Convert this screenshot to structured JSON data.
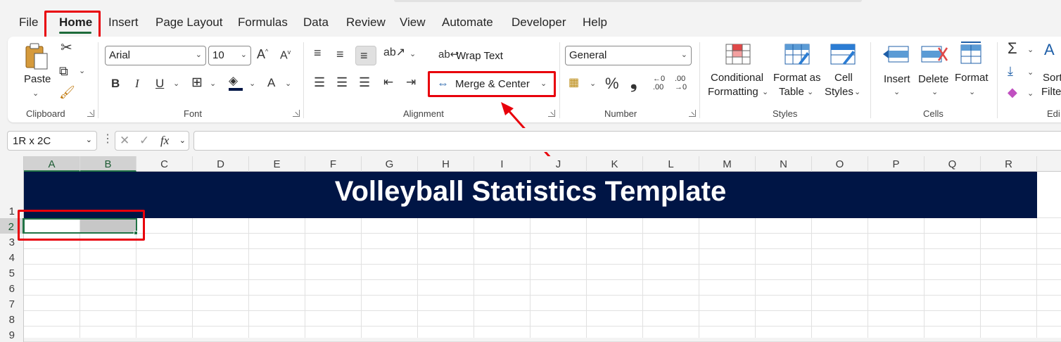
{
  "menu": {
    "tabs": [
      "File",
      "Home",
      "Insert",
      "Page Layout",
      "Formulas",
      "Data",
      "Review",
      "View",
      "Automate",
      "Developer",
      "Help"
    ]
  },
  "ribbon": {
    "clipboard": {
      "paste": "Paste",
      "label": "Clipboard"
    },
    "font": {
      "name": "Arial",
      "size": "10",
      "bold": "B",
      "italic": "I",
      "underline": "U",
      "font_color": "A",
      "grow": "A",
      "shrink": "A",
      "label": "Font"
    },
    "alignment": {
      "wrap_text": "Wrap Text",
      "merge_center": "Merge & Center",
      "label": "Alignment"
    },
    "number": {
      "format": "General",
      "percent": "%",
      "comma": "❟",
      "inc_decimal_top": "←0",
      "inc_decimal_bottom": ".00",
      "dec_decimal_top": ".00",
      "dec_decimal_bottom": "→0",
      "label": "Number"
    },
    "styles": {
      "conditional_1": "Conditional",
      "conditional_2": "Formatting",
      "format_table_1": "Format as",
      "format_table_2": "Table",
      "cell_styles_1": "Cell",
      "cell_styles_2": "Styles",
      "label": "Styles"
    },
    "cells": {
      "insert": "Insert",
      "delete": "Delete",
      "format": "Format",
      "label": "Cells"
    },
    "editing": {
      "sort_1": "Sort",
      "sort_2": "Filte",
      "label": "Edi"
    }
  },
  "formula_bar": {
    "name_box": "1R x 2C",
    "fx": "fx",
    "value": ""
  },
  "grid": {
    "columns": [
      "A",
      "B",
      "C",
      "D",
      "E",
      "F",
      "G",
      "H",
      "I",
      "J",
      "K",
      "L",
      "M",
      "N",
      "O",
      "P",
      "Q",
      "R"
    ],
    "rows": [
      "1",
      "2",
      "3",
      "4",
      "5",
      "6",
      "7",
      "8",
      "9"
    ],
    "banner_title": "Volleyball Statistics Template",
    "selected_columns": [
      "A",
      "B"
    ],
    "selected_row": "2"
  },
  "colors": {
    "accent_green": "#217346",
    "banner_bg": "#001545",
    "highlight_red": "#e8000b"
  }
}
